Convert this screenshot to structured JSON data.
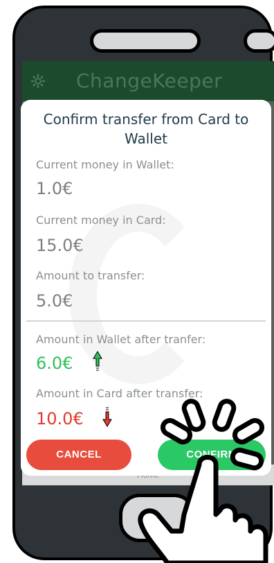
{
  "app": {
    "title": "ChangeKeeper",
    "bottom_nav_label": "Home"
  },
  "dialog": {
    "title_line1": "Confirm transfer from Card to",
    "title_line2": "Wallet",
    "current_wallet_label": "Current money in Wallet:",
    "current_wallet_value": "1.0€",
    "current_card_label": "Current money in Card:",
    "current_card_value": "15.0€",
    "transfer_label": "Amount to transfer:",
    "transfer_value": "5.0€",
    "wallet_after_label": "Amount in Wallet after tranfer:",
    "wallet_after_value": "6.0€",
    "card_after_label": "Amount in Card after transfer:",
    "card_after_value": "10.0€",
    "cancel_label": "CANCEL",
    "confirm_label": "CONFIRM"
  },
  "icons": {
    "settings": "gear-icon",
    "increase": "arrow-up-icon",
    "decrease": "arrow-down-icon",
    "tap_hint": "pointing-hand-icon"
  },
  "colors": {
    "appbar": "#1c4a2c",
    "cancel": "#e84c3c",
    "confirm": "#2bc866",
    "increase": "#2fbf5c",
    "decrease": "#e23a2e"
  }
}
